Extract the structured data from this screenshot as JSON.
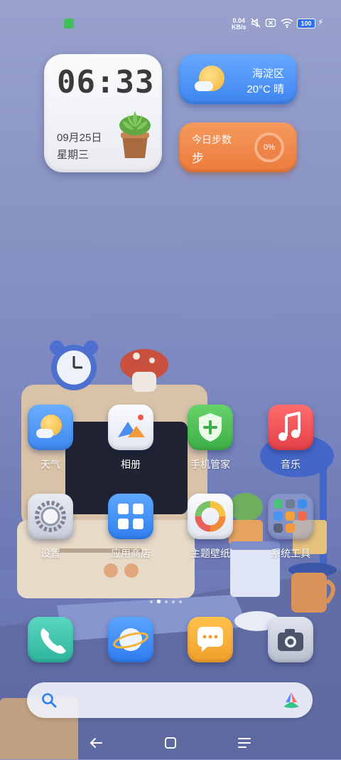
{
  "status_bar": {
    "net_speed_value": "0.04",
    "net_speed_unit": "KB/s",
    "battery": "100",
    "icons": [
      "notification-app-icon",
      "mute-icon",
      "no-sim-icon",
      "wifi-icon",
      "battery-icon",
      "charging-icon"
    ]
  },
  "clock_widget": {
    "time": "06:33",
    "date": "09月25日",
    "weekday": "星期三"
  },
  "weather_widget": {
    "location": "海淀区",
    "temperature_condition": "20°C 晴"
  },
  "steps_widget": {
    "title": "今日步数",
    "unit": "步",
    "progress_label": "0%"
  },
  "apps": [
    {
      "label": "天气",
      "icon": "weather-app-icon"
    },
    {
      "label": "相册",
      "icon": "gallery-app-icon"
    },
    {
      "label": "手机管家",
      "icon": "security-app-icon"
    },
    {
      "label": "音乐",
      "icon": "music-app-icon"
    },
    {
      "label": "设置",
      "icon": "settings-app-icon"
    },
    {
      "label": "应用商店",
      "icon": "app-store-icon"
    },
    {
      "label": "主题壁纸",
      "icon": "themes-app-icon"
    },
    {
      "label": "系统工具",
      "icon": "system-tools-folder-icon"
    }
  ],
  "page_indicator": {
    "pages": 5,
    "active": 2
  },
  "dock": [
    {
      "icon": "phone-icon"
    },
    {
      "icon": "browser-icon"
    },
    {
      "icon": "messages-icon"
    },
    {
      "icon": "camera-icon"
    }
  ],
  "search": {
    "icons": [
      "search-icon",
      "assistant-logo-icon"
    ]
  },
  "nav_bar": {
    "icons": [
      "back-icon",
      "home-icon",
      "recents-icon"
    ]
  },
  "colors": {
    "weather_widget": "#4a90f2",
    "steps_widget": "#ef8543",
    "background": "#7f8bc2"
  }
}
